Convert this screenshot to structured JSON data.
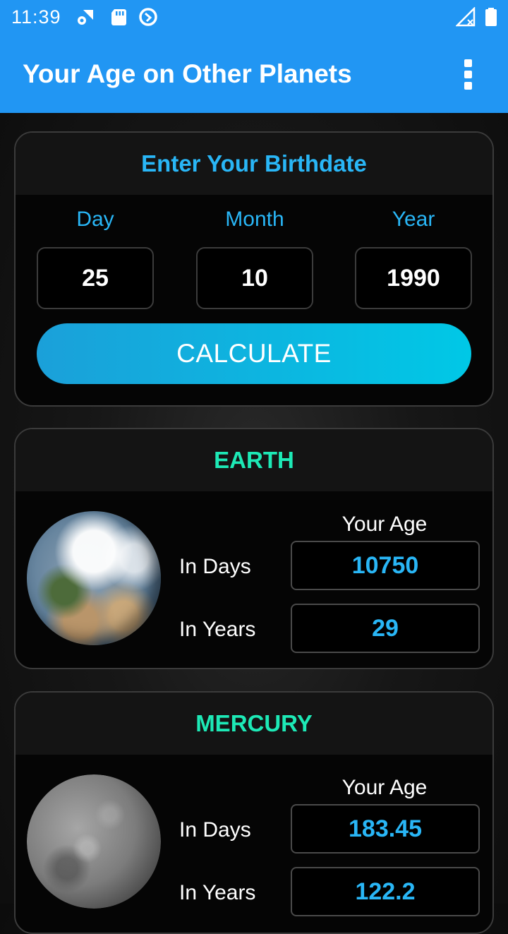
{
  "status_bar": {
    "time": "11:39",
    "icons": [
      "settings-wifi-icon",
      "sd-card-icon",
      "vpn-icon",
      "signal-icon",
      "battery-icon"
    ],
    "color": "#2196f3"
  },
  "app_bar": {
    "title": "Your Age on Other Planets",
    "menu_icon": "more-vert-icon"
  },
  "birthdate": {
    "heading": "Enter Your Birthdate",
    "day_label": "Day",
    "month_label": "Month",
    "year_label": "Year",
    "day_value": "25",
    "month_value": "10",
    "year_value": "1990",
    "calculate_label": "CALCULATE"
  },
  "planets": [
    {
      "name": "EARTH",
      "your_age_label": "Your Age",
      "days_label": "In Days",
      "years_label": "In Years",
      "days_value": "10750",
      "years_value": "29"
    },
    {
      "name": "MERCURY",
      "your_age_label": "Your Age",
      "days_label": "In Days",
      "years_label": "In Years",
      "days_value": "183.45",
      "years_value": "122.2"
    }
  ],
  "colors": {
    "accent_blue": "#29b6f6",
    "planet_title_green": "#1de9b6",
    "button_gradient_start": "#1ba0d9",
    "button_gradient_end": "#00c8e6"
  }
}
